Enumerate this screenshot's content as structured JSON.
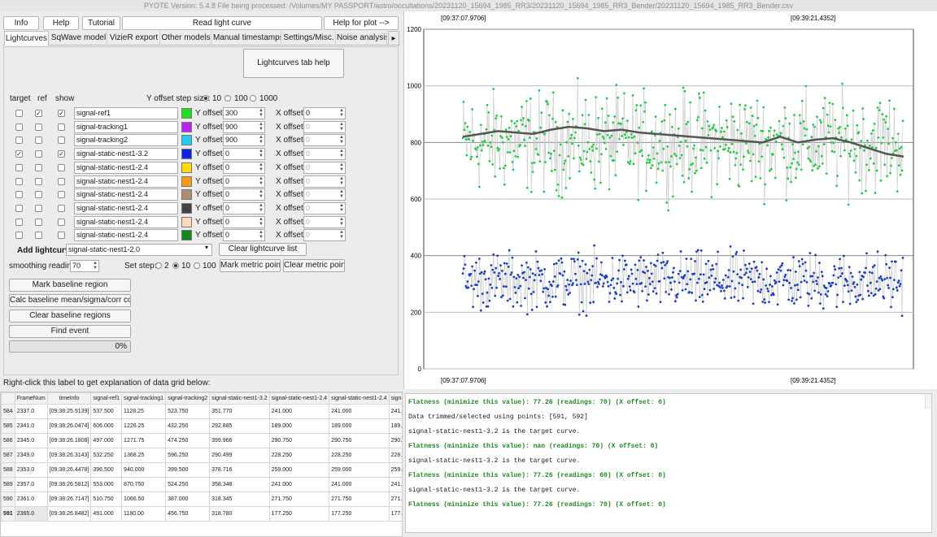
{
  "window": {
    "title": "PYOTE Version: 5.4.8  File being processed: /Volumes/MY PASSPORT/astro/occultations/20231120_15694_1985_RR3/20231120_15694_1985_RR3_Bender/20231120_15694_1985_RR3_Bender.csv"
  },
  "toolbar": {
    "info": "Info",
    "help": "Help",
    "tutorial": "Tutorial",
    "read": "Read light curve",
    "help_plot": "Help for plot -->"
  },
  "tabs": [
    "Lightcurves",
    "SqWave model",
    "VizieR export",
    "Other models",
    "Manual timestamps",
    "Settings/Misc.",
    "Noise analysis/"
  ],
  "tab_arrow": "▸",
  "lc_help": "Lightcurves tab help",
  "headers": {
    "target": "target",
    "ref": "ref",
    "show": "show"
  },
  "yoffset": {
    "label": "Y offset step size:",
    "options": [
      "10",
      "100",
      "1000"
    ],
    "selected": "10"
  },
  "rows": [
    {
      "name": "signal-ref1",
      "color": "#22dd22",
      "target": false,
      "ref": true,
      "show": true,
      "y": "300",
      "x": "0",
      "x_enabled": true
    },
    {
      "name": "signal-tracking1",
      "color": "#bb22ee",
      "target": false,
      "ref": false,
      "show": false,
      "y": "900",
      "x": "0",
      "x_enabled": false
    },
    {
      "name": "signal-tracking2",
      "color": "#22ccee",
      "target": false,
      "ref": false,
      "show": false,
      "y": "900",
      "x": "0",
      "x_enabled": false
    },
    {
      "name": "signal-static-nest1-3.2",
      "color": "#1122dd",
      "target": true,
      "ref": false,
      "show": true,
      "y": "0",
      "x": "0",
      "x_enabled": false
    },
    {
      "name": "signal-static-nest1-2.4",
      "color": "#ffdd00",
      "target": false,
      "ref": false,
      "show": false,
      "y": "0",
      "x": "0",
      "x_enabled": false
    },
    {
      "name": "signal-static-nest1-2.4",
      "color": "#f59a1a",
      "target": false,
      "ref": false,
      "show": false,
      "y": "0",
      "x": "0",
      "x_enabled": false
    },
    {
      "name": "signal-static-nest1-2.4",
      "color": "#b08a73",
      "target": false,
      "ref": false,
      "show": false,
      "y": "0",
      "x": "0",
      "x_enabled": false
    },
    {
      "name": "signal-static-nest1-2.4",
      "color": "#444444",
      "target": false,
      "ref": false,
      "show": false,
      "y": "0",
      "x": "0",
      "x_enabled": false
    },
    {
      "name": "signal-static-nest1-2.4",
      "color": "#ffd9bf",
      "target": false,
      "ref": false,
      "show": false,
      "y": "0",
      "x": "0",
      "x_enabled": false
    },
    {
      "name": "signal-static-nest1-2.4",
      "color": "#118822",
      "target": false,
      "ref": false,
      "show": false,
      "y": "0",
      "x": "0",
      "x_enabled": false
    }
  ],
  "row_labels": {
    "y": "Y offset:",
    "x": "X offset:"
  },
  "add": {
    "label": "Add lightcurve",
    "value": "signal-static-nest1-2.0",
    "clear": "Clear lightcurve list"
  },
  "smoothing": {
    "label": "smoothing readings",
    "value": "70",
    "setstep": "Set step:",
    "options": [
      "2",
      "10",
      "100"
    ],
    "selected": "10",
    "mark": "Mark metric points",
    "clear": "Clear metric points"
  },
  "actions": {
    "mark_baseline": "Mark baseline region",
    "calc_baseline": "Calc baseline mean/sigma/corr coeffs",
    "clear_baseline": "Clear baseline regions",
    "find_event": "Find event",
    "progress": "0%"
  },
  "grid_hint": "Right-click this label to get explanation of data grid below:",
  "table": {
    "columns": [
      "FrameNum",
      "timeInfo",
      "signal-ref1",
      "signal-tracking1",
      "signal-tracking2",
      "signal-static-nest1-3.2",
      "signal-static-nest1-2.4",
      "signal-static-nest1-2.4",
      "signal-stati"
    ],
    "rows": [
      {
        "id": "584",
        "cells": [
          "2337.0",
          "[09:38:25.9139]",
          "537.500",
          "1128.25",
          "523.750",
          "351.770",
          "241.000",
          "241.000",
          "241.000"
        ]
      },
      {
        "id": "585",
        "cells": [
          "2341.0",
          "[09:38:26.0474]",
          "606.000",
          "1226.25",
          "432.250",
          "292.885",
          "189.000",
          "189.000",
          "189.000"
        ]
      },
      {
        "id": "586",
        "cells": [
          "2345.0",
          "[09:38:26.1808]",
          "497.000",
          "1271.75",
          "474.250",
          "399.966",
          "290.750",
          "290.750",
          "290.750"
        ]
      },
      {
        "id": "587",
        "cells": [
          "2349.0",
          "[09:38:26.3143]",
          "532.250",
          "1368.25",
          "596.250",
          "290.499",
          "228.250",
          "228.250",
          "228.250"
        ]
      },
      {
        "id": "588",
        "cells": [
          "2353.0",
          "[09:38:26.4478]",
          "396.500",
          "940.000",
          "399.500",
          "378.716",
          "259.000",
          "259.000",
          "259.000"
        ]
      },
      {
        "id": "589",
        "cells": [
          "2357.0",
          "[09:38:26.5812]",
          "553.000",
          "870.750",
          "524.250",
          "358.348",
          "241.000",
          "241.000",
          "241.000"
        ]
      },
      {
        "id": "590",
        "cells": [
          "2361.0",
          "[09:38:26.7147]",
          "510.750",
          "1066.50",
          "387.000",
          "318.345",
          "271.750",
          "271.750",
          "271.750"
        ]
      },
      {
        "id": "591",
        "cells": [
          "2365.0",
          "[09:38:26.8482]",
          "491.000",
          "1180.00",
          "456.750",
          "318.780",
          "177.250",
          "177.250",
          "177.250"
        ]
      }
    ]
  },
  "log": [
    {
      "text": "Flatness (minimize this value): 77.26 (readings: 70) (X offset: 0)",
      "green": true
    },
    {
      "text": "Data trimmed/selected using points: [591, 592]",
      "green": false
    },
    {
      "text": "signal-static-nest1-3.2 is the target curve.",
      "green": false
    },
    {
      "text": "Flatness (minimize this value): nan (readings: 70) (X offset: 0)",
      "green": true
    },
    {
      "text": "signal-static-nest1-3.2 is the target curve.",
      "green": false
    },
    {
      "text": "Flatness (minimize this value): 77.26 (readings: 60) (X offset: 0)",
      "green": true
    },
    {
      "text": "signal-static-nest1-3.2 is the target curve.",
      "green": false
    },
    {
      "text": "Flatness (minimize this value): 77.26 (readings: 70) (X offset: 0)",
      "green": true
    }
  ],
  "chart_data": {
    "type": "scatter",
    "top_ticks": [
      "[09:37:07.9706]",
      "[09:39:21.4352]"
    ],
    "bottom_ticks": [
      "[09:37:07.9706]",
      "[09:39:21.4352]"
    ],
    "ylim": [
      0,
      1200
    ],
    "yticks": [
      0,
      200,
      400,
      600,
      800,
      1000,
      1200
    ],
    "grid": true,
    "series": [
      {
        "color": "#22cc44",
        "center": 800,
        "spread": 130,
        "points": 560
      },
      {
        "color": "#1a3fc0",
        "center": 310,
        "spread": 75,
        "points": 560
      }
    ],
    "smoothed": {
      "color": "#555555",
      "values": [
        820,
        830,
        840,
        835,
        830,
        845,
        855,
        850,
        840,
        845,
        835,
        830,
        825,
        820,
        815,
        810,
        805,
        800,
        820,
        800,
        810,
        815,
        800,
        780,
        760,
        750
      ]
    }
  }
}
